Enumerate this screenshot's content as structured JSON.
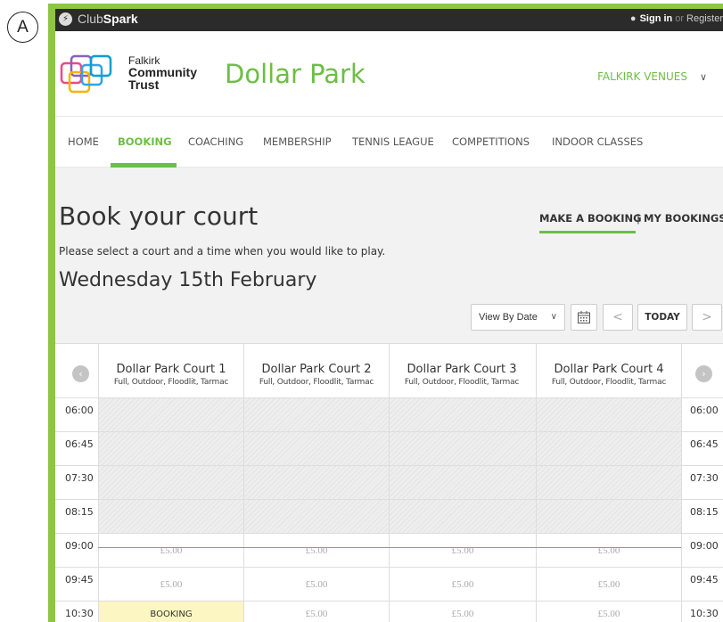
{
  "marker": "A",
  "topbar": {
    "brand_club": "Club",
    "brand_spark": "Spark",
    "sign_in": "Sign in",
    "or": "or",
    "register": "Register"
  },
  "header": {
    "org_line1": "Falkirk",
    "org_line2": "Community",
    "org_line3": "Trust",
    "venue_title": "Dollar Park",
    "venues_link": "FALKIRK VENUES"
  },
  "nav": {
    "items": [
      "HOME",
      "BOOKING",
      "COACHING",
      "MEMBERSHIP",
      "TENNIS LEAGUE",
      "COMPETITIONS",
      "INDOOR CLASSES"
    ],
    "active": "BOOKING"
  },
  "page": {
    "title": "Book your court",
    "make_booking": "MAKE A BOOKING",
    "separator": "|",
    "my_bookings": "MY BOOKINGS",
    "instruction": "Please select a court and a time when you would like to play.",
    "date": "Wednesday 15th February"
  },
  "controls": {
    "view_select": "View By Date",
    "today": "TODAY"
  },
  "courts": [
    {
      "name": "Dollar Park Court 1",
      "desc": "Full, Outdoor, Floodlit, Tarmac"
    },
    {
      "name": "Dollar Park Court 2",
      "desc": "Full, Outdoor, Floodlit, Tarmac"
    },
    {
      "name": "Dollar Park Court 3",
      "desc": "Full, Outdoor, Floodlit, Tarmac"
    },
    {
      "name": "Dollar Park Court 4",
      "desc": "Full, Outdoor, Floodlit, Tarmac"
    }
  ],
  "times": [
    "06:00",
    "06:45",
    "07:30",
    "08:15",
    "09:00",
    "09:45",
    "10:30"
  ],
  "slots": [
    [
      "",
      "",
      "",
      ""
    ],
    [
      "",
      "",
      "",
      ""
    ],
    [
      "",
      "",
      "",
      ""
    ],
    [
      "",
      "",
      "",
      ""
    ],
    [
      "£5.00",
      "£5.00",
      "£5.00",
      "£5.00"
    ],
    [
      "£5.00",
      "£5.00",
      "£5.00",
      "£5.00"
    ],
    [
      "BOOKING",
      "£5.00",
      "£5.00",
      "£5.00"
    ]
  ],
  "colors": {
    "accent": "#6dbe45",
    "frame": "#8dc63f",
    "booked": "#fbf6c2",
    "now_line": "#e57373"
  }
}
